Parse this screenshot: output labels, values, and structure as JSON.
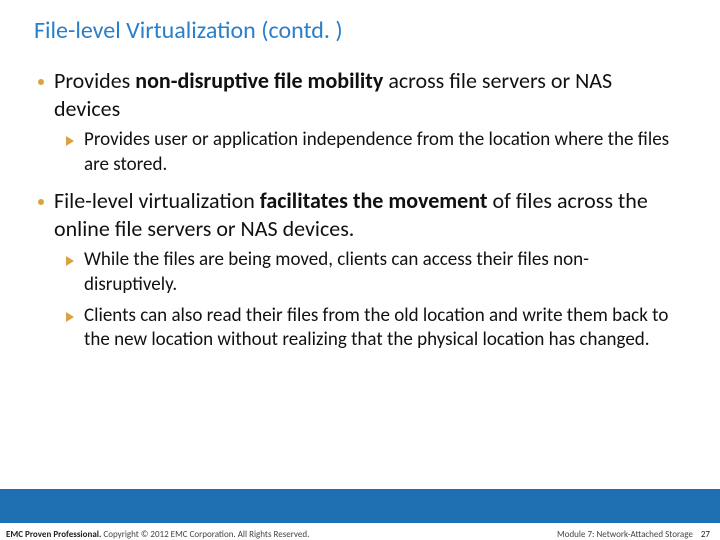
{
  "title": "File-level Virtualization (contd. )",
  "bullets": [
    {
      "level": 1,
      "pre": "Provides ",
      "bold": "non-disruptive file mobility",
      "post": " across file servers or NAS devices"
    },
    {
      "level": 2,
      "text": "Provides user or application independence from the location where the files are stored."
    },
    {
      "level": 1,
      "pre": "File-level virtualization ",
      "bold": "facilitates the movement",
      "post": " of files across the online file servers or NAS devices."
    },
    {
      "level": 2,
      "text": "While the files are being moved, clients can access their files non-disruptively."
    },
    {
      "level": 2,
      "text": "Clients can also read their files from the old location and write them back to the new location without realizing that the physical location has changed."
    }
  ],
  "footer": {
    "brand": "EMC Proven Professional.",
    "copyright": " Copyright © 2012 EMC Corporation. All Rights Reserved.",
    "module": "Module 7: Network-Attached Storage",
    "page": "27"
  }
}
